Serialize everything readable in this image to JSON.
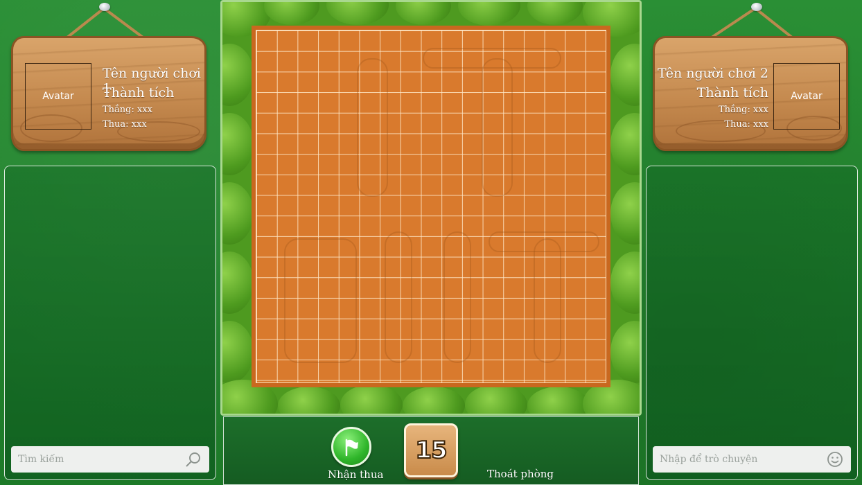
{
  "player1": {
    "avatar_label": "Avatar",
    "name": "Tên người chơi 1",
    "achievement_label": "Thành tích",
    "wins": "Thắng: xxx",
    "losses": "Thua: xxx"
  },
  "player2": {
    "avatar_label": "Avatar",
    "name": "Tên người chơi 2",
    "achievement_label": "Thành tích",
    "wins": "Thắng: xxx",
    "losses": "Thua: xxx"
  },
  "left_panel": {
    "search_placeholder": "Tìm kiếm",
    "icon": "search-icon"
  },
  "right_panel": {
    "chat_placeholder": "Nhập để trò chuyện",
    "icon": "smiley-icon"
  },
  "controls": {
    "surrender_label": "Nhận thua",
    "surrender_icon": "flag-icon",
    "timer": "15",
    "leave_label": "Thoát phòng"
  },
  "colors": {
    "grass": "#1f7a2a",
    "board_orange": "#d97a2d",
    "grid_line": "#ffe8c8",
    "wood": "#c58a4f",
    "button_green": "#2fb52a"
  }
}
